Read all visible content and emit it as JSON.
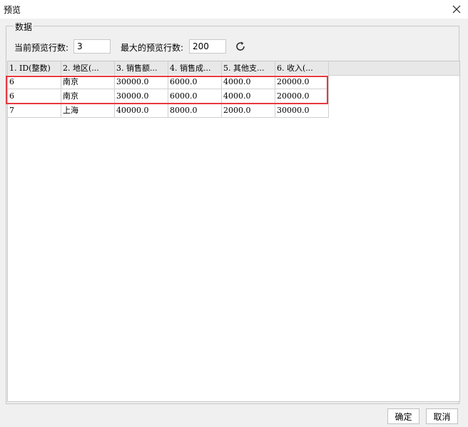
{
  "window": {
    "title": "预览"
  },
  "group": {
    "legend": "数据"
  },
  "controls": {
    "current_rows_label": "当前预览行数:",
    "current_rows_value": "3",
    "max_rows_label": "最大的预览行数:",
    "max_rows_value": "200"
  },
  "table": {
    "columns": [
      "1. ID(整数)",
      "2. 地区(...",
      "3. 销售额...",
      "4. 销售成...",
      "5. 其他支...",
      "6. 收入(..."
    ],
    "rows": [
      [
        "6",
        "南京",
        "30000.0",
        "6000.0",
        "4000.0",
        "20000.0"
      ],
      [
        "6",
        "南京",
        "30000.0",
        "6000.0",
        "4000.0",
        "20000.0"
      ],
      [
        "7",
        "上海",
        "40000.0",
        "8000.0",
        "2000.0",
        "30000.0"
      ]
    ]
  },
  "footer": {
    "confirm_label": "确定",
    "cancel_label": "取消"
  },
  "colors": {
    "highlight": "#e8393e",
    "header_bg": "#e8e8e8"
  },
  "icons": {
    "close": "close-icon",
    "refresh": "refresh-icon"
  }
}
